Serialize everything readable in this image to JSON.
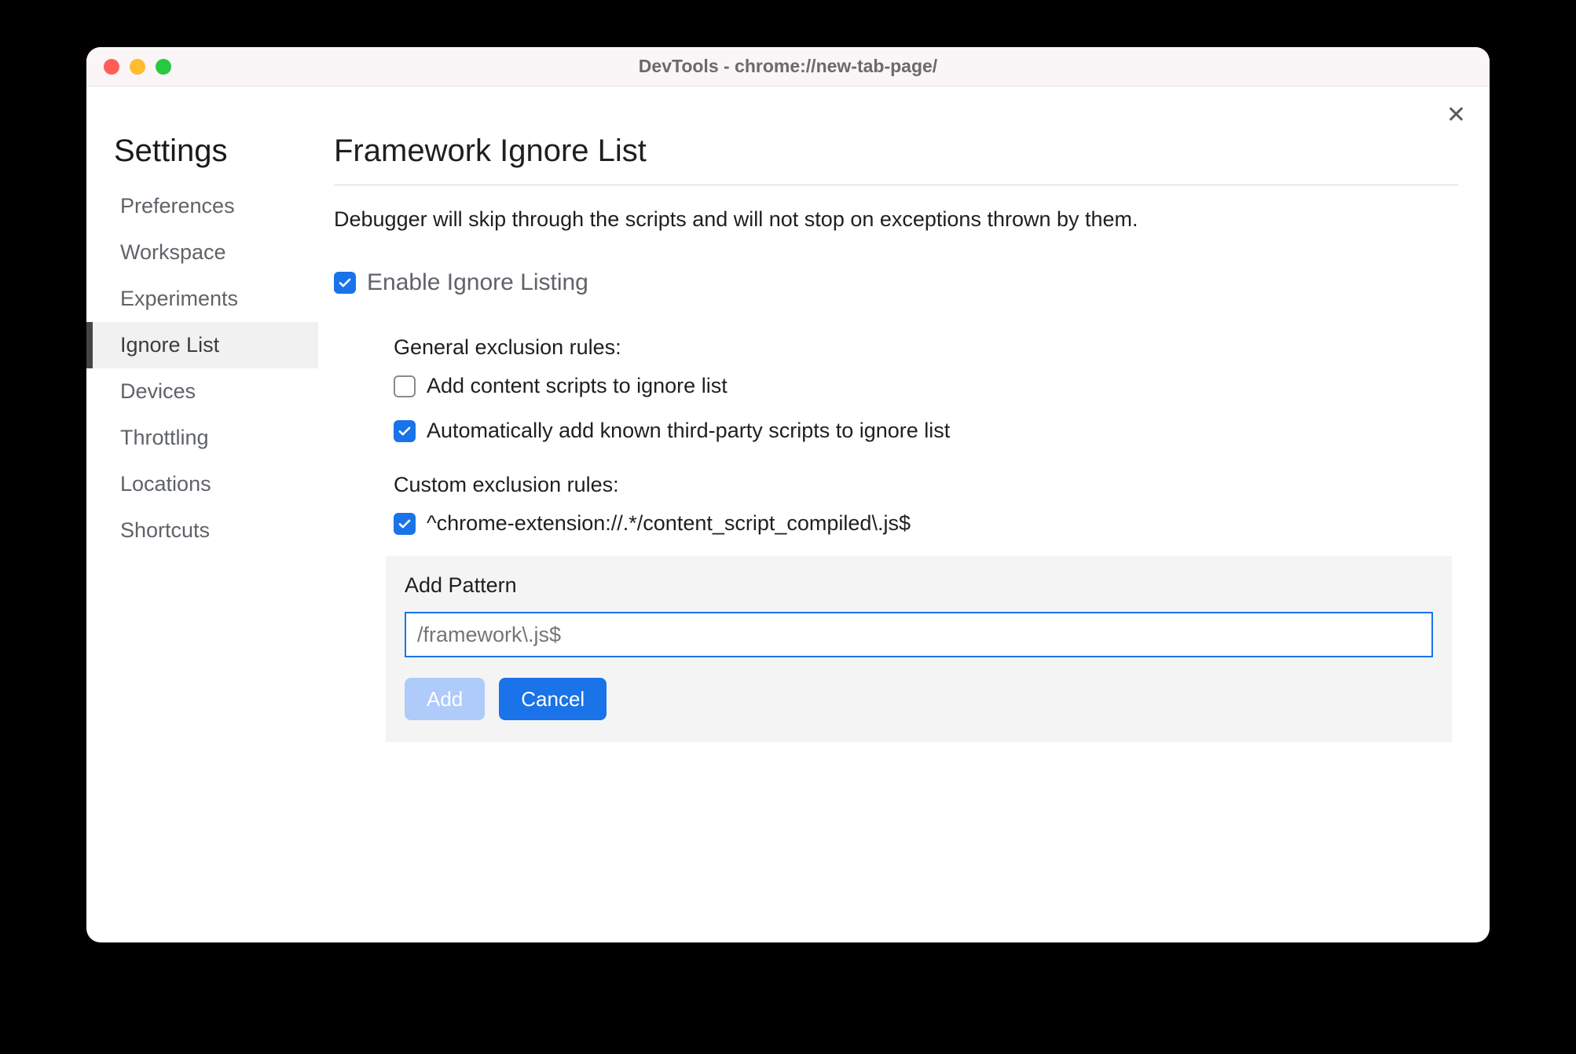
{
  "window": {
    "title": "DevTools - chrome://new-tab-page/"
  },
  "sidebar": {
    "heading": "Settings",
    "items": [
      {
        "label": "Preferences",
        "active": false
      },
      {
        "label": "Workspace",
        "active": false
      },
      {
        "label": "Experiments",
        "active": false
      },
      {
        "label": "Ignore List",
        "active": true
      },
      {
        "label": "Devices",
        "active": false
      },
      {
        "label": "Throttling",
        "active": false
      },
      {
        "label": "Locations",
        "active": false
      },
      {
        "label": "Shortcuts",
        "active": false
      }
    ]
  },
  "main": {
    "heading": "Framework Ignore List",
    "description": "Debugger will skip through the scripts and will not stop on exceptions thrown by them.",
    "enable": {
      "checked": true,
      "label": "Enable Ignore Listing"
    },
    "general": {
      "heading": "General exclusion rules:",
      "rules": [
        {
          "checked": false,
          "label": "Add content scripts to ignore list"
        },
        {
          "checked": true,
          "label": "Automatically add known third-party scripts to ignore list"
        }
      ]
    },
    "custom": {
      "heading": "Custom exclusion rules:",
      "rules": [
        {
          "checked": true,
          "label": "^chrome-extension://.*/content_script_compiled\\.js$"
        }
      ]
    },
    "addPattern": {
      "heading": "Add Pattern",
      "placeholder": "/framework\\.js$",
      "addLabel": "Add",
      "cancelLabel": "Cancel"
    }
  }
}
